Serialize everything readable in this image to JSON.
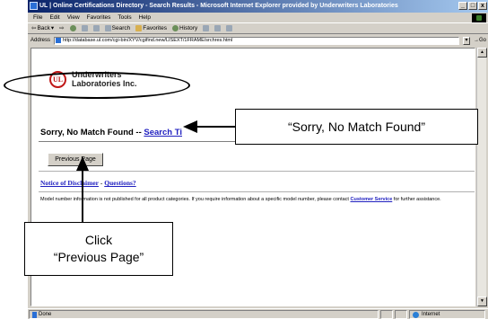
{
  "window": {
    "title": "UL | Online Certifications Directory - Search Results - Microsoft Internet Explorer provided by Underwriters Laboratories"
  },
  "menubar": [
    "File",
    "Edit",
    "View",
    "Favorites",
    "Tools",
    "Help"
  ],
  "toolbar": {
    "back": "Back",
    "search": "Search",
    "favorites": "Favorites",
    "history": "History"
  },
  "addressbar": {
    "label": "Address",
    "url": "http://database.ul.com/cgi-bin/XYV/cgifind.new/LISEXT/1FRAME/srchres.html",
    "go": "Go"
  },
  "page": {
    "logo_mark": "UL",
    "brand_line1": "Underwriters",
    "brand_line2": "Laboratories Inc.",
    "heading": "Sorry, No Match Found",
    "heading_sep": " -- ",
    "heading_link": "Search Ti",
    "prev_button": "Previous Page",
    "disclaimer_link": "Notice of Disclaimer",
    "links_sep": " - ",
    "questions_link": "Questions?",
    "note_part1": "Model number information is not published for all product categories. If you require information about a specific model number, please contact",
    "note_link": "Customer Service",
    "note_part2": "for further assistance."
  },
  "annotations": {
    "callout_top": "“Sorry, No Match Found”",
    "callout_bottom_line1": "Click",
    "callout_bottom_line2": "“Previous Page”"
  },
  "statusbar": {
    "status": "Done",
    "zone": "Internet"
  },
  "colors": {
    "titlebar_start": "#0a246a",
    "link": "#2020c0",
    "ul_red": "#c01818"
  }
}
